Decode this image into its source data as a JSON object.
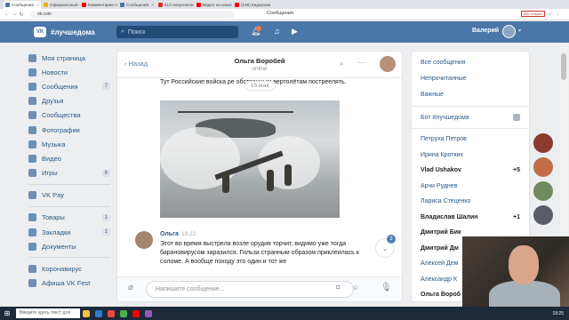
{
  "browser": {
    "tabs": [
      {
        "label": "Сообщения",
        "active": true,
        "color": "#4a76a8"
      },
      {
        "label": "Официальный сайт Мар",
        "active": false,
        "color": "#f0b000"
      },
      {
        "label": "Комментарии на канале",
        "active": false,
        "color": "#ff0000"
      },
      {
        "label": "Сообщения",
        "active": false,
        "color": "#4a76a8"
      },
      {
        "label": "413 непрочитанных чатов",
        "active": false,
        "color": "#d93025"
      },
      {
        "label": "Видео на канале - YouTube",
        "active": false,
        "color": "#ff0000"
      },
      {
        "label": "(196) Кадырова на суде",
        "active": false,
        "color": "#ff0000"
      }
    ],
    "url": "vk.com",
    "window_title": "Сообщения",
    "ext_badge": "63К отзыво"
  },
  "header": {
    "brand": "#лучшедома",
    "search_placeholder": "Поиск",
    "user_name": "Валерий"
  },
  "sidebar": {
    "items": [
      {
        "label": "Моя страница",
        "count": ""
      },
      {
        "label": "Новости",
        "count": ""
      },
      {
        "label": "Сообщения",
        "count": "7"
      },
      {
        "label": "Друзья",
        "count": ""
      },
      {
        "label": "Сообщества",
        "count": ""
      },
      {
        "label": "Фотографии",
        "count": ""
      },
      {
        "label": "Музыка",
        "count": ""
      },
      {
        "label": "Видео",
        "count": ""
      },
      {
        "label": "Игры",
        "count": "6"
      }
    ],
    "items2": [
      {
        "label": "VK Pay",
        "count": ""
      }
    ],
    "items3": [
      {
        "label": "Товары",
        "count": "1"
      },
      {
        "label": "Закладки",
        "count": "1"
      },
      {
        "label": "Документы",
        "count": ""
      }
    ],
    "items4": [
      {
        "label": "Коронавирус",
        "count": ""
      },
      {
        "label": "Афиша VK Fest",
        "count": ""
      }
    ]
  },
  "chat": {
    "back_label": "Назад",
    "contact_name": "Ольга Воробей",
    "status": "online",
    "msg1_text": "Тут Российские войска ре обственным вертолётам постреелять.",
    "date_pill": "15 мая",
    "msg2_author": "Ольга",
    "msg2_time": "19:22",
    "msg2_text": "Этот во время выстрела возле орудия торчит, видимо уже тогда барановирусом заразился. Гильза странным образом приклеилась к соломе. А вообще походу это один и тот же",
    "unread_count": "3",
    "input_placeholder": "Напишите сообщение..."
  },
  "right_panel": {
    "folders": [
      "Все сообщения",
      "Непрочитанные",
      "Важные"
    ],
    "bot": "Бот #лучшедома",
    "contacts": [
      {
        "name": "Петруха Петров",
        "unread": "",
        "bold": false
      },
      {
        "name": "Ирина Кротких",
        "unread": "",
        "bold": false
      },
      {
        "name": "Vlad Ushakov",
        "unread": "+5",
        "bold": true
      },
      {
        "name": "Арчи Руднев",
        "unread": "",
        "bold": false
      },
      {
        "name": "Лариса Стеценко",
        "unread": "",
        "bold": false
      },
      {
        "name": "Владислав Шалин",
        "unread": "+1",
        "bold": true
      },
      {
        "name": "Дмитрий Бик",
        "unread": "",
        "bold": true
      },
      {
        "name": "Дмитрий Дм",
        "unread": "",
        "bold": true
      },
      {
        "name": "Алексей Дем",
        "unread": "",
        "bold": false
      },
      {
        "name": "Александр К",
        "unread": "",
        "bold": false
      },
      {
        "name": "Ольга Вороб",
        "unread": "",
        "bold": true
      }
    ]
  },
  "taskbar": {
    "search_placeholder": "Введите здесь текст для поиска",
    "clock": "19:25"
  }
}
